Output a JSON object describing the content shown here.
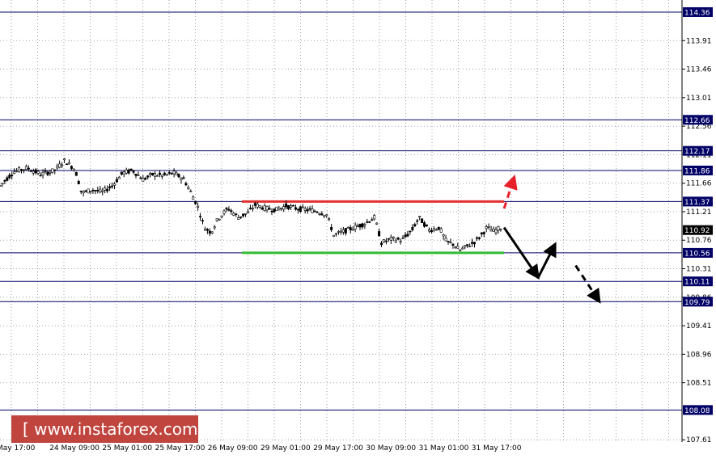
{
  "watermark": "[  www.instaforex.com ]",
  "colors": {
    "background": "#ffffff",
    "grid": "#9aa0aa",
    "level_line": "#000066",
    "level_label_bg": "#000066",
    "current_label_bg": "#000000",
    "resistance": "#e03030",
    "support": "#33bb33",
    "candle": "#000000",
    "forecast_up": "#e8202a",
    "forecast_down": "#000000",
    "watermark_bg": "#c0453f"
  },
  "chart_data": {
    "type": "candlestick",
    "ylim": [
      107.6,
      114.5
    ],
    "y_ticks": [
      "113.91",
      "113.46",
      "113.01",
      "112.56",
      "112.11",
      "111.66",
      "111.21",
      "110.76",
      "110.31",
      "109.86",
      "109.41",
      "108.96",
      "108.51",
      "107.61"
    ],
    "x_ticks": [
      "May 17:00",
      "24 May 09:00",
      "25 May 01:00",
      "25 May 17:00",
      "26 May 09:00",
      "29 May 01:00",
      "29 May 17:00",
      "30 May 09:00",
      "31 May 01:00",
      "31 May 17:00"
    ],
    "grid": true,
    "levels": [
      {
        "value": 114.36,
        "label": "114.36"
      },
      {
        "value": 112.66,
        "label": "112.66"
      },
      {
        "value": 112.17,
        "label": "112.17"
      },
      {
        "value": 111.86,
        "label": "111.86"
      },
      {
        "value": 111.37,
        "label": "111.37"
      },
      {
        "value": 110.56,
        "label": "110.56"
      },
      {
        "value": 110.11,
        "label": "110.11"
      },
      {
        "value": 109.79,
        "label": "109.79"
      },
      {
        "value": 108.08,
        "label": "108.08"
      }
    ],
    "current_price": {
      "value": 110.92,
      "label": "110.92"
    },
    "resistance_line": {
      "value": 111.37,
      "x_from": 0.355,
      "x_to": 0.74
    },
    "support_line": {
      "value": 110.56,
      "x_from": 0.355,
      "x_to": 0.74
    },
    "price_path": [
      [
        0.0,
        111.62
      ],
      [
        0.02,
        111.84
      ],
      [
        0.04,
        111.9
      ],
      [
        0.06,
        111.8
      ],
      [
        0.08,
        111.86
      ],
      [
        0.095,
        112.02
      ],
      [
        0.11,
        111.88
      ],
      [
        0.115,
        111.7
      ],
      [
        0.12,
        111.5
      ],
      [
        0.135,
        111.56
      ],
      [
        0.15,
        111.52
      ],
      [
        0.165,
        111.62
      ],
      [
        0.18,
        111.82
      ],
      [
        0.195,
        111.86
      ],
      [
        0.21,
        111.72
      ],
      [
        0.225,
        111.8
      ],
      [
        0.24,
        111.78
      ],
      [
        0.255,
        111.82
      ],
      [
        0.27,
        111.72
      ],
      [
        0.28,
        111.52
      ],
      [
        0.29,
        111.3
      ],
      [
        0.3,
        110.96
      ],
      [
        0.31,
        110.88
      ],
      [
        0.32,
        111.1
      ],
      [
        0.335,
        111.26
      ],
      [
        0.35,
        111.12
      ],
      [
        0.365,
        111.2
      ],
      [
        0.375,
        111.32
      ],
      [
        0.39,
        111.26
      ],
      [
        0.405,
        111.24
      ],
      [
        0.42,
        111.3
      ],
      [
        0.435,
        111.26
      ],
      [
        0.45,
        111.24
      ],
      [
        0.465,
        111.22
      ],
      [
        0.48,
        111.16
      ],
      [
        0.49,
        110.84
      ],
      [
        0.505,
        110.9
      ],
      [
        0.52,
        110.96
      ],
      [
        0.535,
        111.02
      ],
      [
        0.55,
        111.12
      ],
      [
        0.56,
        110.72
      ],
      [
        0.575,
        110.78
      ],
      [
        0.59,
        110.76
      ],
      [
        0.605,
        110.92
      ],
      [
        0.615,
        111.12
      ],
      [
        0.63,
        110.92
      ],
      [
        0.645,
        110.96
      ],
      [
        0.655,
        110.74
      ],
      [
        0.665,
        110.7
      ],
      [
        0.675,
        110.6
      ],
      [
        0.685,
        110.66
      ],
      [
        0.695,
        110.72
      ],
      [
        0.705,
        110.82
      ],
      [
        0.715,
        110.96
      ],
      [
        0.725,
        110.9
      ],
      [
        0.735,
        110.96
      ]
    ],
    "forecast_arrows": [
      {
        "style": "dashed",
        "color_key": "forecast_up",
        "from": [
          0.74,
          111.26
        ],
        "to": [
          0.755,
          111.76
        ]
      },
      {
        "style": "solid",
        "color_key": "forecast_down",
        "from": [
          0.74,
          110.96
        ],
        "to": [
          0.79,
          110.17
        ]
      },
      {
        "style": "solid",
        "color_key": "forecast_down",
        "from": [
          0.79,
          110.17
        ],
        "to": [
          0.815,
          110.7
        ]
      },
      {
        "style": "dashed",
        "color_key": "forecast_down",
        "from": [
          0.845,
          110.36
        ],
        "to": [
          0.88,
          109.79
        ]
      }
    ]
  }
}
